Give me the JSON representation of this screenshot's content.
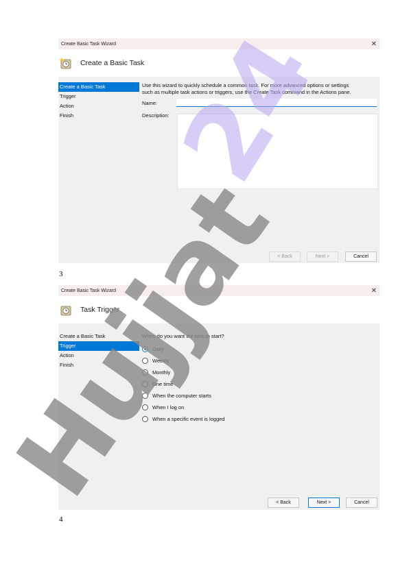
{
  "wizard1": {
    "window_title": "Create Basic Task Wizard",
    "close_glyph": "✕",
    "header_title": "Create a Basic Task",
    "sidebar": [
      "Create a Basic Task",
      "Trigger",
      "Action",
      "Finish"
    ],
    "active_index": 0,
    "intro_line1": "Use this wizard to quickly schedule a common task.  For more advanced options or settings",
    "intro_line2": "such as multiple task actions or triggers, use the Create Task command in the Actions pane.",
    "name_label": "Name:",
    "name_value": "",
    "description_label": "Description:",
    "back_label": "< Back",
    "next_label": "Next >",
    "cancel_label": "Cancel"
  },
  "page_number_1": "3",
  "wizard2": {
    "window_title": "Create Basic Task Wizard",
    "close_glyph": "✕",
    "header_title": "Task Trigger",
    "sidebar": [
      "Create a Basic Task",
      "Trigger",
      "Action",
      "Finish"
    ],
    "active_index": 1,
    "question": "When do you want the task to start?",
    "options": [
      "Daily",
      "Weekly",
      "Monthly",
      "One time",
      "When the computer starts",
      "When I log on",
      "When a specific event is logged"
    ],
    "selected_option": "Daily",
    "back_label": "< Back",
    "next_label": "Next >",
    "cancel_label": "Cancel"
  },
  "page_number_2": "4",
  "watermark": {
    "text": "Hujjat 24",
    "icon": "task-scheduler-icon",
    "colors": {
      "gray": "#8c8c8c",
      "purple": "#b8a6f2"
    }
  }
}
